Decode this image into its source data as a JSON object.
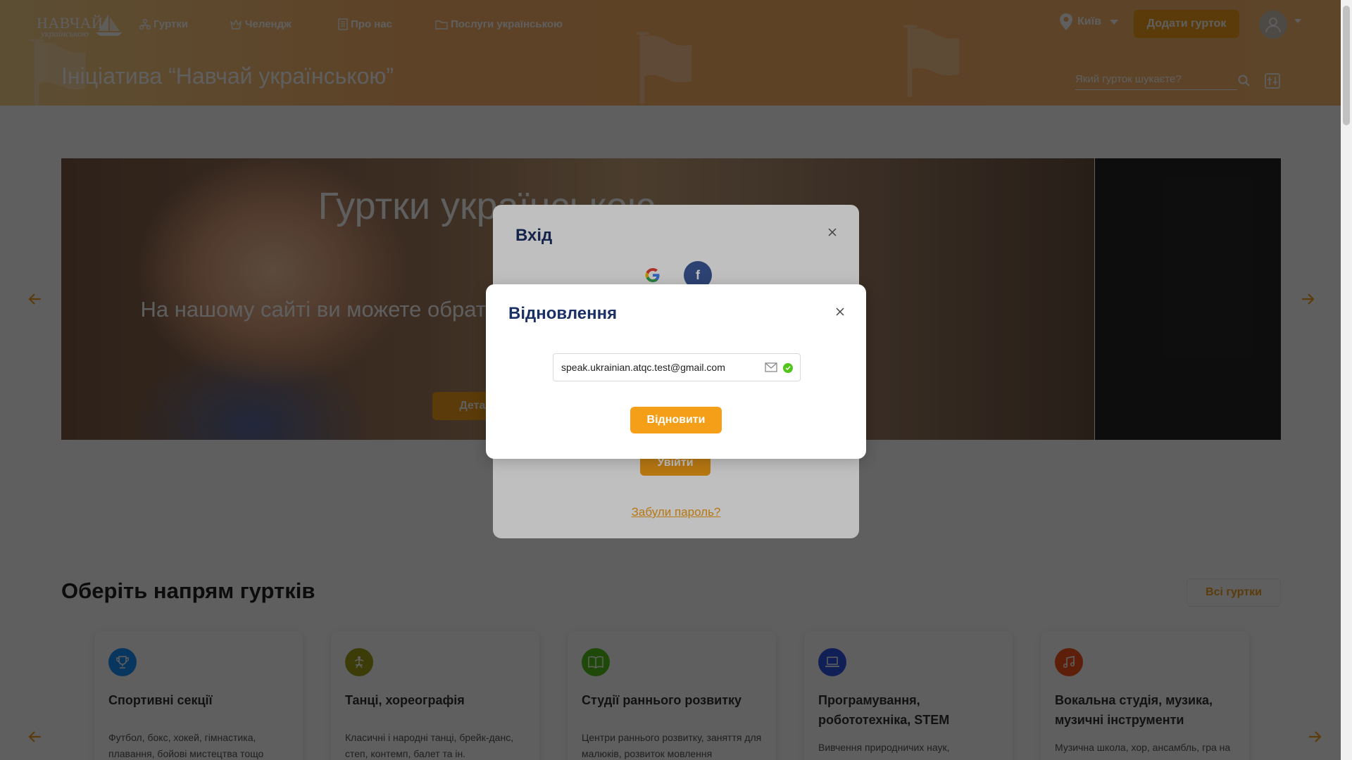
{
  "header": {
    "logo_line1": "НАВЧАЙ",
    "logo_line2": "українською",
    "nav": [
      {
        "label": "Гуртки",
        "icon": "clubs-icon"
      },
      {
        "label": "Челендж",
        "icon": "challenge-icon"
      },
      {
        "label": "Про нас",
        "icon": "about-icon"
      },
      {
        "label": "Послуги українською",
        "icon": "folder-icon"
      }
    ],
    "city": "Київ",
    "add_club_button": "Додати гурток",
    "page_title": "Ініціатива “Навчай українською”",
    "search_placeholder": "Який гурток шукаєте?"
  },
  "carousel": {
    "title": "Гуртки українською",
    "text": "На нашому сайті ви можете обрати гурток, де навчають українською",
    "details_button": "Детальніше"
  },
  "categories": {
    "title": "Оберіть напрям гуртків",
    "all_button": "Всі гуртки",
    "items": [
      {
        "title": "Спортивні секції",
        "desc": "Футбол, бокс, хокей, гімнастика, плавання, бойові мистецтва тощо",
        "icon": "trophy-icon",
        "color": "#1890ff"
      },
      {
        "title": "Танці, хореографія",
        "desc": "Класичні і народні танці, брейк-данс, степ, контемп, балет та ін.",
        "icon": "dance-icon",
        "color": "#a0a11b"
      },
      {
        "title": "Студії раннього розвитку",
        "desc": "Центри раннього розвитку, заняття для малюків, розвиток мовлення",
        "icon": "book-icon",
        "color": "#52c41a"
      },
      {
        "title": "Програмування, робототехніка, STEM",
        "desc": "Вивчення природничих наук,",
        "icon": "laptop-icon",
        "color": "#2f54eb"
      },
      {
        "title": "Вокальна студія, музика, музичні інструменти",
        "desc": "Музична школа, хор, ансамбль, гра на",
        "icon": "music-icon",
        "color": "#fa541c"
      }
    ]
  },
  "login_modal": {
    "title": "Вхід",
    "login_button": "Увійти",
    "forgot_link": "Забули пароль?"
  },
  "recovery_modal": {
    "title": "Відновлення",
    "email_value": "speak.ukrainian.atqc.test@gmail.com",
    "submit_button": "Відновити"
  },
  "colors": {
    "accent": "#f59f18",
    "title_blue": "#1b3165",
    "success": "#52c41a"
  }
}
